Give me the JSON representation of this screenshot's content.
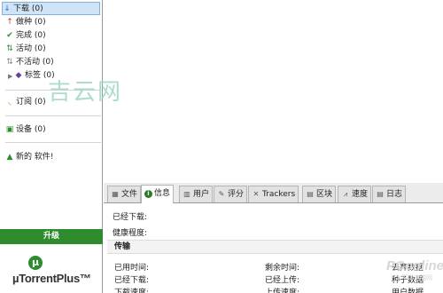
{
  "sidebar": {
    "categories": [
      {
        "label": "下载 (0)",
        "icon": "download-arrow-icon",
        "color": "#2c6fd1",
        "glyph": "↓"
      },
      {
        "label": "做种 (0)",
        "icon": "seed-arrow-icon",
        "color": "#c0392b",
        "glyph": "↑"
      },
      {
        "label": "完成 (0)",
        "icon": "check-icon",
        "color": "#2e8b2e",
        "glyph": "✔"
      },
      {
        "label": "活动 (0)",
        "icon": "activity-icon",
        "color": "#2e8b2e",
        "glyph": "⇅"
      },
      {
        "label": "不活动 (0)",
        "icon": "inactive-icon",
        "color": "#888888",
        "glyph": "⇅"
      },
      {
        "label": "标签 (0)",
        "icon": "label-icon",
        "color": "#6a3d9a",
        "glyph": "◆"
      }
    ],
    "feeds": {
      "label": "订阅 (0)",
      "icon": "rss-icon",
      "glyph": "◟"
    },
    "devices": {
      "label": "设备 (0)",
      "icon": "device-icon",
      "glyph": "▣"
    },
    "new_software": {
      "label": "新的 软件!",
      "icon": "app-icon",
      "glyph": "▲"
    },
    "upgrade": "升级",
    "logo": "µTorrentPlus™",
    "logo_mark": "µ"
  },
  "watermark": "吉云网",
  "tabs": [
    {
      "label": "文件",
      "icon": "files-icon",
      "glyph": "▦"
    },
    {
      "label": "信息",
      "icon": "info-icon",
      "glyph": "i"
    },
    {
      "label": "用户",
      "icon": "peers-icon",
      "glyph": "▥"
    },
    {
      "label": "评分",
      "icon": "rating-icon",
      "glyph": "✎"
    },
    {
      "label": "Trackers",
      "icon": "trackers-icon",
      "glyph": "✕"
    },
    {
      "label": "区块",
      "icon": "pieces-icon",
      "glyph": "▤"
    },
    {
      "label": "速度",
      "icon": "speed-icon",
      "glyph": "⩘"
    },
    {
      "label": "日志",
      "icon": "log-icon",
      "glyph": "▤"
    }
  ],
  "info": {
    "downloaded": "已经下载:",
    "availability": "健康程度:",
    "section": "传输",
    "time_elapsed": "已用时间:",
    "remaining": "剩余时间:",
    "wasted": "丢弃数据",
    "downloaded2": "已经下载:",
    "uploaded": "已经上传:",
    "seeds": "种子数据",
    "dl_speed": "下载速度:",
    "ul_speed": "上传速度:",
    "peers": "用户数据"
  },
  "site_watermark": "PConline",
  "site_watermark_sub": "太平洋电脑网"
}
